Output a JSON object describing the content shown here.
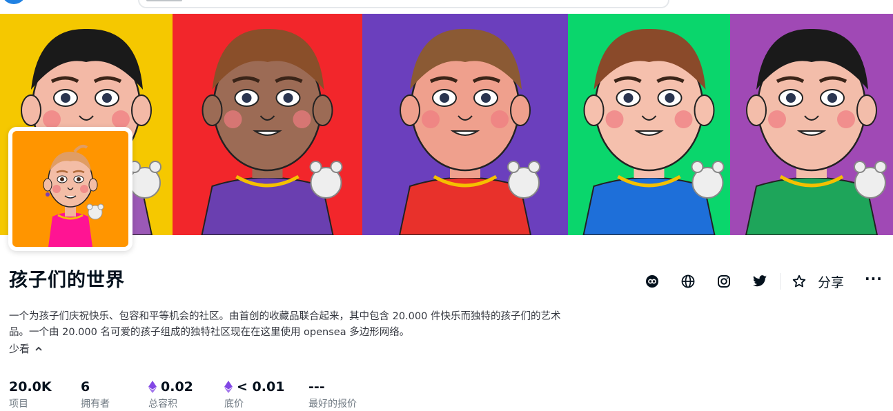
{
  "header": {
    "search": {
      "placeholder": "搜索"
    }
  },
  "banner": {
    "panels": [
      {
        "bg": "#f5c800",
        "hair": "#1a1a1a",
        "skin": "#f3b9a6",
        "dress": "#9b59b6"
      },
      {
        "bg": "#f2262b",
        "hair": "#8a4f2a",
        "skin": "#9c6b55",
        "dress": "#6a3fb0"
      },
      {
        "bg": "#6b3fbd",
        "hair": "#8b5a34",
        "skin": "#efa08d",
        "dress": "#e8312b"
      },
      {
        "bg": "#0ad66c",
        "hair": "#8a4a2a",
        "skin": "#f5c0ad",
        "dress": "#1e6fd9"
      },
      {
        "bg": "#a049b5",
        "hair": "#1a1a1a",
        "skin": "#f3bdaa",
        "dress": "#1ea55a"
      }
    ]
  },
  "collection": {
    "name": "孩子们的世界",
    "avatar_bg": "#ff9500",
    "description_line1": "一个为孩子们庆祝快乐、包容和平等机会的社区。由首创的收藏品联合起来，其中包含 20.000 件快乐而独特的孩子们的艺术",
    "description_line2": "品。一个由 20.000 名可爱的孩子组成的独特社区现在在这里使用 opensea 多边形网络。",
    "toggle_label": "少看",
    "share_label": "分享",
    "more_label": "···"
  },
  "stats": [
    {
      "value": "20.0K",
      "label": "项目",
      "eth": false
    },
    {
      "value": "6",
      "label": "拥有者",
      "eth": false
    },
    {
      "value": "0.02",
      "label": "总容积",
      "eth": true
    },
    {
      "value": "< 0.01",
      "label": "底价",
      "eth": true
    },
    {
      "value": "---",
      "label": "最好的报价",
      "eth": false
    }
  ],
  "colors": {
    "accent": "#2081e2",
    "eth": "#8247e5",
    "text": "#04111d",
    "muted": "#707a83"
  }
}
